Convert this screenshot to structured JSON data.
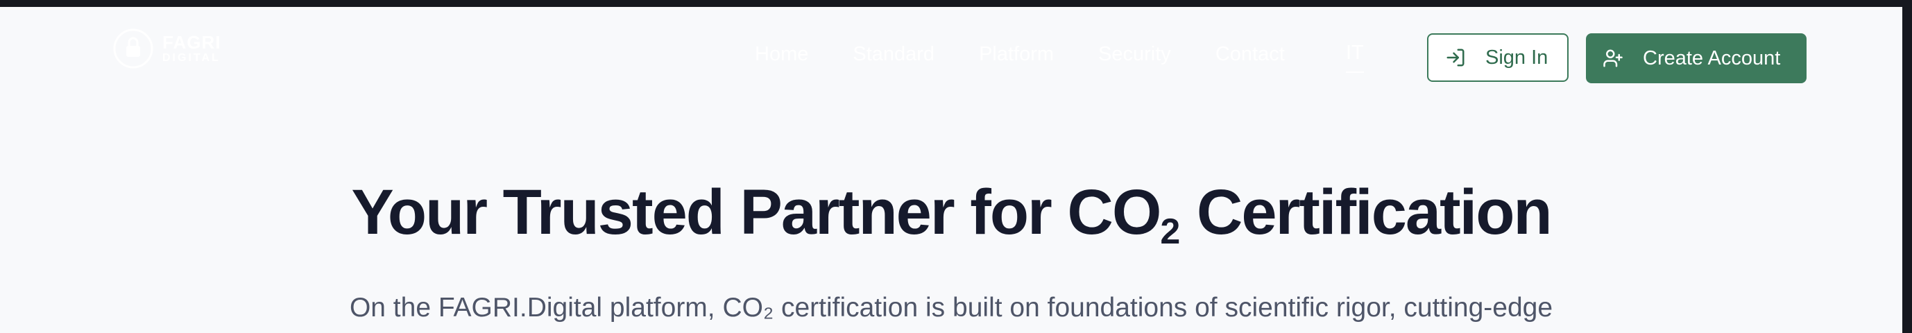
{
  "header": {
    "logo": {
      "line1": "FAGRI",
      "line2": "DIGITAL",
      "icon": "lock-leaf-icon"
    },
    "nav": [
      {
        "label": "Home"
      },
      {
        "label": "Standard"
      },
      {
        "label": "Platform"
      },
      {
        "label": "Security"
      },
      {
        "label": "Contact"
      }
    ],
    "language": "IT",
    "sign_in": {
      "label": "Sign In",
      "icon": "login-icon"
    },
    "create_account": {
      "label": "Create Account",
      "icon": "user-plus-icon"
    }
  },
  "hero": {
    "title_main": "Your Trusted Partner for CO",
    "title_sub": "2",
    "title_end": " Certification",
    "subtitle": "On the FAGRI.Digital platform, CO₂ certification is built on foundations of scientific rigor, cutting-edge"
  },
  "colors": {
    "accent": "#3d7a5c",
    "accent_border": "#3b7a5a",
    "title": "#161a2c",
    "subtitle": "#4e5568",
    "background": "#f8f9fb",
    "frame": "#16181f"
  }
}
